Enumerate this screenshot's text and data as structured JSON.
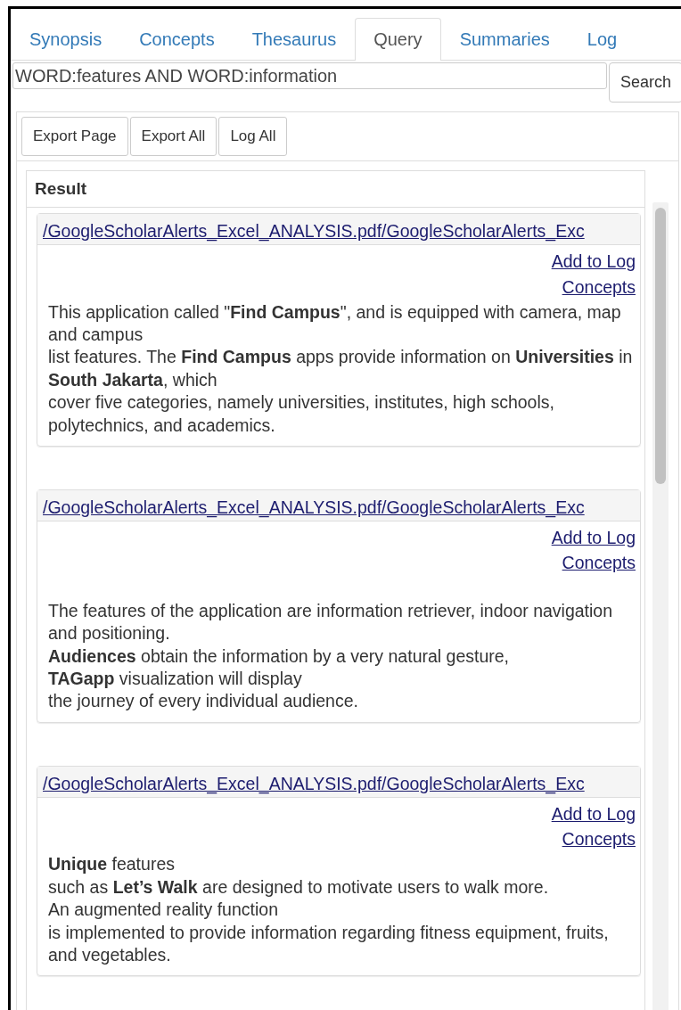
{
  "tabs": [
    {
      "label": "Synopsis",
      "selected": false
    },
    {
      "label": "Concepts",
      "selected": false
    },
    {
      "label": "Thesaurus",
      "selected": false
    },
    {
      "label": "Query",
      "selected": true
    },
    {
      "label": "Summaries",
      "selected": false
    },
    {
      "label": "Log",
      "selected": false
    }
  ],
  "query": {
    "value": "WORD:features AND WORD:information"
  },
  "search_button": "Search",
  "toolbar": [
    "Export Page",
    "Export All",
    "Log All"
  ],
  "results": {
    "heading": "Result",
    "items": [
      {
        "path": "/GoogleScholarAlerts_Excel_ANALYSIS.pdf/GoogleScholarAlerts_Exc",
        "actions": [
          "Add to Log",
          "Concepts"
        ],
        "text": "This application called \"**Find Campus**\", and is equipped with camera, map and campus\nlist features. The **Find Campus** apps provide information on **Universities** in **South Jakarta**, which\ncover five categories, namely universities, institutes, high schools, polytechnics, and academics."
      },
      {
        "path": "/GoogleScholarAlerts_Excel_ANALYSIS.pdf/GoogleScholarAlerts_Exc",
        "actions": [
          "Add to Log",
          "Concepts"
        ],
        "text": "\nThe features of the application are information retriever, indoor navigation and positioning.\n**Audiences** obtain the information by a very natural gesture,\n**TAGapp** visualization will display\nthe journey of every individual audience."
      },
      {
        "path": "/GoogleScholarAlerts_Excel_ANALYSIS.pdf/GoogleScholarAlerts_Exc",
        "actions": [
          "Add to Log",
          "Concepts"
        ],
        "text": "**Unique** features\nsuch as **Let’s Walk** are designed to motivate users to walk more.\nAn augmented reality function\nis implemented to provide information regarding fitness equipment, fruits, and vegetables."
      }
    ]
  }
}
